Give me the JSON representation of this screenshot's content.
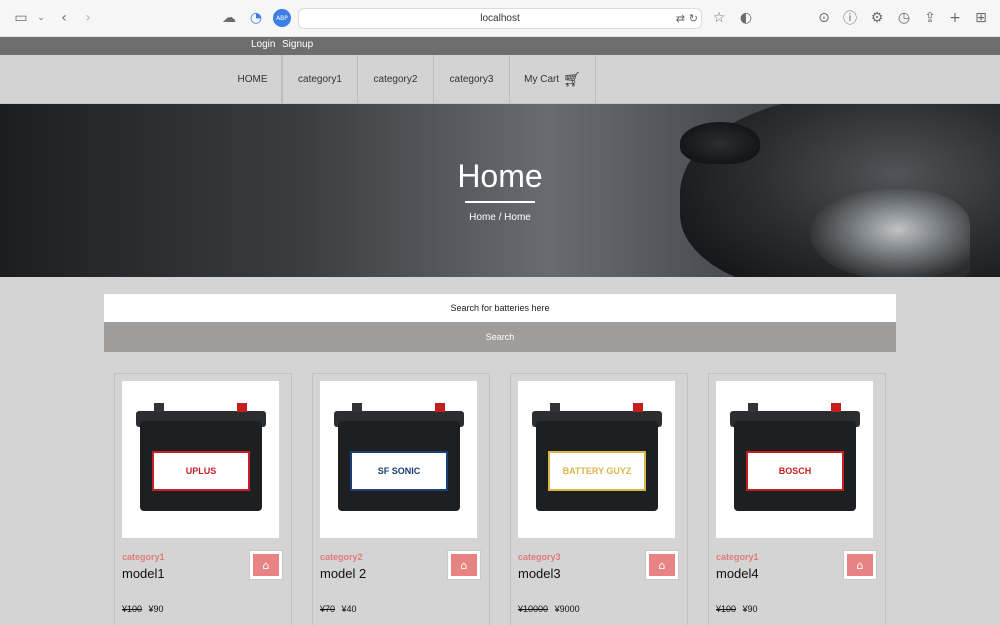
{
  "browser": {
    "url": "localhost",
    "abp_label": "ABP"
  },
  "auth": {
    "login": "Login",
    "signup": "Signup"
  },
  "nav": {
    "items": [
      "HOME",
      "category1",
      "category2",
      "category3",
      "My Cart"
    ]
  },
  "hero": {
    "title": "Home",
    "breadcrumb": "Home  /  Home"
  },
  "search": {
    "placeholder": "Search for batteries here",
    "button": "Search"
  },
  "products": [
    {
      "category": "category1",
      "model": "model1",
      "old_price": "¥100",
      "price": "¥90",
      "brand_text": "UPLUS",
      "label_color": "#c81e2a"
    },
    {
      "category": "category2",
      "model": "model 2",
      "old_price": "¥70",
      "price": "¥40",
      "brand_text": "SF SONIC",
      "label_color": "#1b3f7a"
    },
    {
      "category": "category3",
      "model": "model3",
      "old_price": "¥10000",
      "price": "¥9000",
      "brand_text": "BATTERY GUYZ",
      "label_color": "#d8b64a"
    },
    {
      "category": "category1",
      "model": "model4",
      "old_price": "¥100",
      "price": "¥90",
      "brand_text": "BOSCH",
      "label_color": "#c41e1e"
    }
  ],
  "colors": {
    "category_text": "#e07b7b",
    "bag_button": "#e88383",
    "search_button": "#9e9d9b"
  }
}
